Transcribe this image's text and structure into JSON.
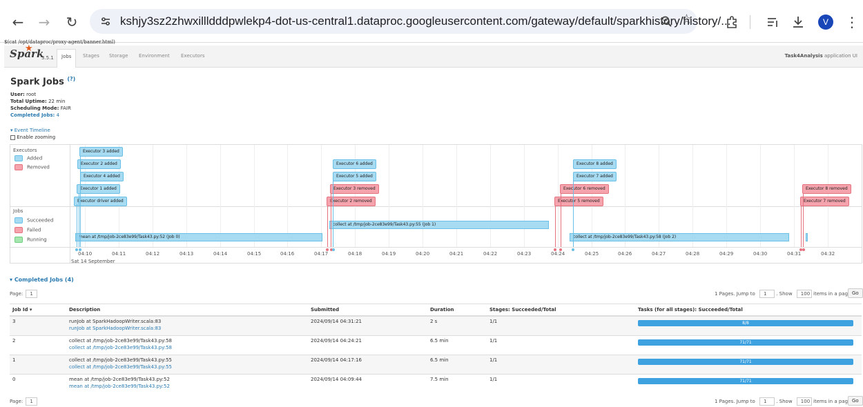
{
  "browser": {
    "url": "kshjy3sz2zhwxillldddpwlekp4-dot-us-central1.dataproc.googleusercontent.com/gateway/default/sparkhistory/history/...",
    "avatar_letter": "V"
  },
  "banner_text": "$(cat /opt/dataproc/proxy-agent/banner.html)",
  "navbar": {
    "logo": "Spark",
    "version": "3.5.1",
    "tabs": [
      "Jobs",
      "Stages",
      "Storage",
      "Environment",
      "Executors"
    ],
    "app_name": "Task4Analysis",
    "app_suffix": "application UI"
  },
  "page": {
    "title": "Spark Jobs",
    "help": "(?)",
    "user_label": "User:",
    "user": "root",
    "uptime_label": "Total Uptime:",
    "uptime": "22 min",
    "mode_label": "Scheduling Mode:",
    "mode": "FAIR",
    "completed_label": "Completed Jobs:",
    "completed": "4",
    "event_timeline": "Event Timeline",
    "enable_zooming": "Enable zooming"
  },
  "timeline": {
    "executors_title": "Executors",
    "added": "Added",
    "removed": "Removed",
    "jobs_title": "Jobs",
    "succeeded": "Succeeded",
    "failed": "Failed",
    "running": "Running",
    "ticks": [
      "04:10",
      "04:11",
      "04:12",
      "04:13",
      "04:14",
      "04:15",
      "04:16",
      "04:17",
      "04:18",
      "04:19",
      "04:20",
      "04:21",
      "04:22",
      "04:23",
      "04:24",
      "04:25",
      "04:26",
      "04:27",
      "04:28",
      "04:29",
      "04:30",
      "04:31",
      "04:32"
    ],
    "date": "Sat 14 September",
    "events": {
      "e3": "Executor 3 added",
      "e2": "Executor 2 added",
      "e4": "Executor 4 added",
      "e1": "Executor 1 added",
      "edriver": "Executor driver added",
      "e6": "Executor 6 added",
      "e5": "Executor 5 added",
      "e3r": "Executor 3 removed",
      "e2r": "Executor 2 removed",
      "e8": "Executor 8 added",
      "e7": "Executor 7 added",
      "e6r": "Executor 6 removed",
      "e5r": "Executor 5 removed",
      "e8r": "Executor 8 removed",
      "e7r": "Executor 7 removed"
    },
    "jobs": {
      "job0": "mean at /tmp/job-2ce83e99/Task43.py:52 (Job 0)",
      "job1": "collect at /tmp/job-2ce83e99/Task43.py:55 (Job 1)",
      "job2": "collect at /tmp/job-2ce83e99/Task43.py:58 (Job 2)"
    },
    "colors": {
      "added": "#a7dbf2",
      "removed": "#f5a4ad",
      "running": "#a6e7b0",
      "accent": "#2a7ab0"
    }
  },
  "completed": {
    "heading": "Completed Jobs (4)",
    "page_label": "Page:",
    "page_num": "1",
    "pager_text": "1 Pages. Jump to",
    "jump_value": "1",
    "show_label": ". Show",
    "show_value": "100",
    "items_label": "items in a page.",
    "go": "Go",
    "columns": [
      "Job Id ▾",
      "Description",
      "Submitted",
      "Duration",
      "Stages: Succeeded/Total",
      "Tasks (for all stages): Succeeded/Total"
    ],
    "rows": [
      {
        "id": "3",
        "desc": "runJob at SparkHadoopWriter.scala:83",
        "link": "runJob at SparkHadoopWriter.scala:83",
        "submitted": "2024/09/14 04:31:21",
        "duration": "2 s",
        "stages": "1/1",
        "tasks": "8/8",
        "tasks_done": 1.0
      },
      {
        "id": "2",
        "desc": "collect at /tmp/job-2ce83e99/Task43.py:58",
        "link": "collect at /tmp/job-2ce83e99/Task43.py:58",
        "submitted": "2024/09/14 04:24:21",
        "duration": "6.5 min",
        "stages": "1/1",
        "tasks": "71/71",
        "tasks_done": 1.0
      },
      {
        "id": "1",
        "desc": "collect at /tmp/job-2ce83e99/Task43.py:55",
        "link": "collect at /tmp/job-2ce83e99/Task43.py:55",
        "submitted": "2024/09/14 04:17:16",
        "duration": "6.5 min",
        "stages": "1/1",
        "tasks": "71/71",
        "tasks_done": 1.0
      },
      {
        "id": "0",
        "desc": "mean at /tmp/job-2ce83e99/Task43.py:52",
        "link": "mean at /tmp/job-2ce83e99/Task43.py:52",
        "submitted": "2024/09/14 04:09:44",
        "duration": "7.5 min",
        "stages": "1/1",
        "tasks": "71/71",
        "tasks_done": 1.0
      }
    ]
  }
}
